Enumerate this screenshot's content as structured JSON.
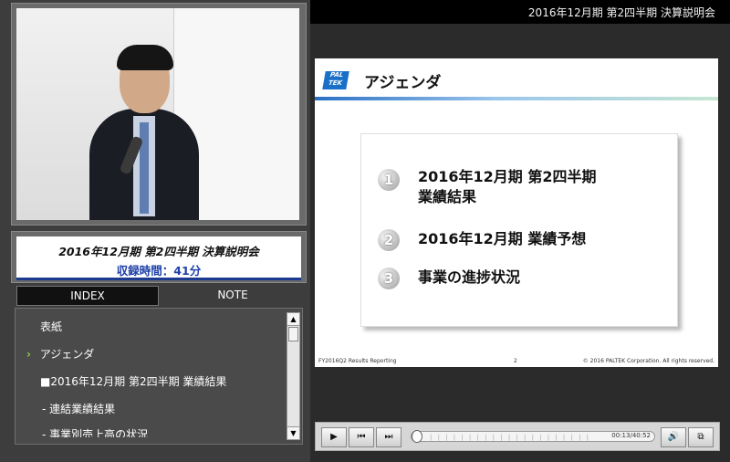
{
  "window": {
    "title": "2016年12月期 第2四半期 決算説明会"
  },
  "session": {
    "title": "2016年12月期  第2四半期  決算説明会",
    "duration": "収録時間：41分"
  },
  "tabs": {
    "index": "INDEX",
    "note": "NOTE"
  },
  "index_items": [
    {
      "label": "表紙",
      "active": false
    },
    {
      "label": "アジェンダ",
      "active": true,
      "marker": "›"
    },
    {
      "label": "■2016年12月期 第2四半期 業績結果",
      "active": false
    },
    {
      "label": "-  連結業績結果",
      "active": false
    },
    {
      "label": "-  事業別売上高の状況",
      "active": false
    }
  ],
  "slide": {
    "logo": "PAL TEK",
    "heading": "アジェンダ",
    "agenda": [
      {
        "num": "1",
        "text": "2016年12月期 第2四半期\n業績結果"
      },
      {
        "num": "2",
        "text": "2016年12月期  業績予想"
      },
      {
        "num": "3",
        "text": "事業の進捗状況"
      }
    ],
    "footer_left": "FY2016Q2 Results Reporting",
    "page": "2",
    "footer_right": "© 2016 PALTEK Corporation. All rights reserved."
  },
  "player": {
    "time": "00:13/40:52"
  },
  "colors": {
    "accent_blue": "#1d3fa8",
    "marker_green": "#8bd23a"
  }
}
